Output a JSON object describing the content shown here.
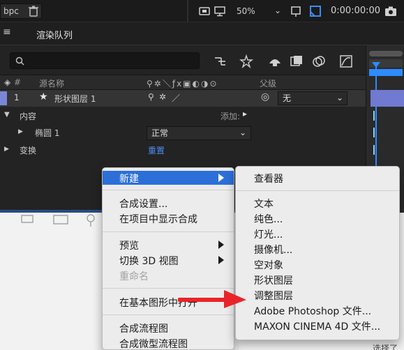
{
  "toolbar": {
    "bpc": "bpc",
    "zoom": "50%",
    "timecode": "0:00:00:00"
  },
  "panel": {
    "tab": "渲染队列"
  },
  "columns": {
    "number": "#",
    "source_name": "源名称",
    "parent": "父级"
  },
  "layer": {
    "index": "1",
    "name": "形状图层 1",
    "parent_value": "无"
  },
  "properties": {
    "contents": "内容",
    "add": "添加:",
    "ellipse": "椭圆 1",
    "blend_mode": "正常",
    "transform": "变换",
    "reset": "重置"
  },
  "menu_main": {
    "items": [
      {
        "label": "新建",
        "submenu": true,
        "highlighted": true
      },
      {
        "label": "合成设置..."
      },
      {
        "label": "在项目中显示合成"
      },
      {
        "label": "预览",
        "submenu": true
      },
      {
        "label": "切换 3D 视图",
        "submenu": true
      },
      {
        "label": "重命名",
        "disabled": true
      },
      {
        "label": "在基本图形中打开"
      },
      {
        "label": "合成流程图"
      },
      {
        "label": "合成微型流程图"
      }
    ]
  },
  "menu_new": {
    "items": [
      {
        "label": "查看器"
      },
      {
        "label": "文本"
      },
      {
        "label": "纯色..."
      },
      {
        "label": "灯光..."
      },
      {
        "label": "摄像机..."
      },
      {
        "label": "空对象"
      },
      {
        "label": "形状图层"
      },
      {
        "label": "调整图层"
      },
      {
        "label": "Adobe Photoshop 文件..."
      },
      {
        "label": "MAXON CINEMA 4D 文件..."
      }
    ]
  },
  "footer_text": "选择了",
  "colors": {
    "highlight": "#2c6fd9",
    "label_swatch": "#7b87d6",
    "link_blue": "#4c8ef2",
    "annotation_arrow": "#e8242a",
    "playhead": "#2d8cff"
  }
}
